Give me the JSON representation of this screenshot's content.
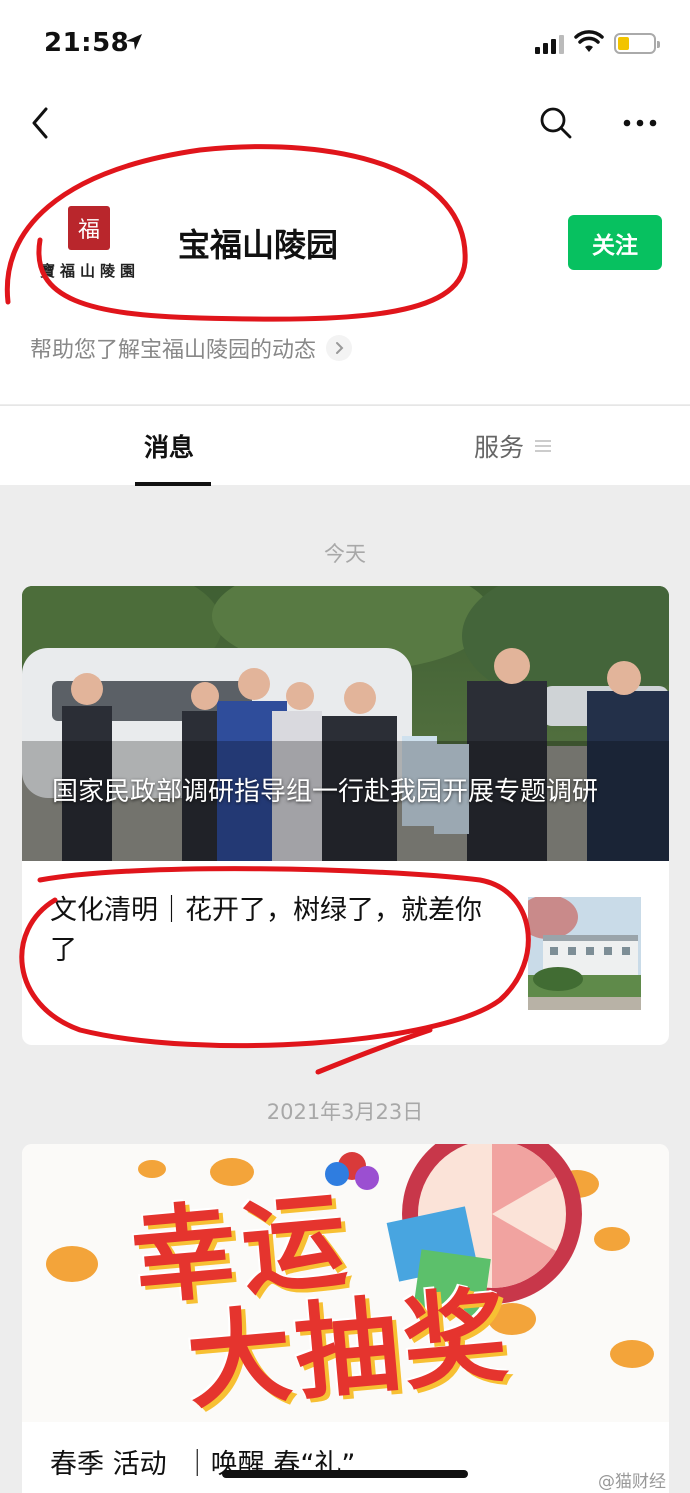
{
  "status_bar": {
    "time": "21:58"
  },
  "account": {
    "name": "宝福山陵园",
    "logo_seal_text": "福",
    "logo_text": "寶福山陵園",
    "follow_label": "关注",
    "description": "帮助您了解宝福山陵园的动态"
  },
  "tabs": {
    "messages": "消息",
    "services": "服务"
  },
  "feed": [
    {
      "date": "今天",
      "main_headline": "国家民政部调研指导组一行赴我园开展专题调研",
      "sub_article_title": "文化清明｜花开了，树绿了，就差你了"
    },
    {
      "date": "2021年3月23日",
      "cover_text_top": "幸运",
      "cover_text_bottom": "大抽奖",
      "main_headline": "春季 活动  ｜唤醒 春“礼”"
    }
  ],
  "watermark": "@猫财经",
  "colors": {
    "follow_green": "#07c160",
    "annotation_red": "#e0151b"
  }
}
